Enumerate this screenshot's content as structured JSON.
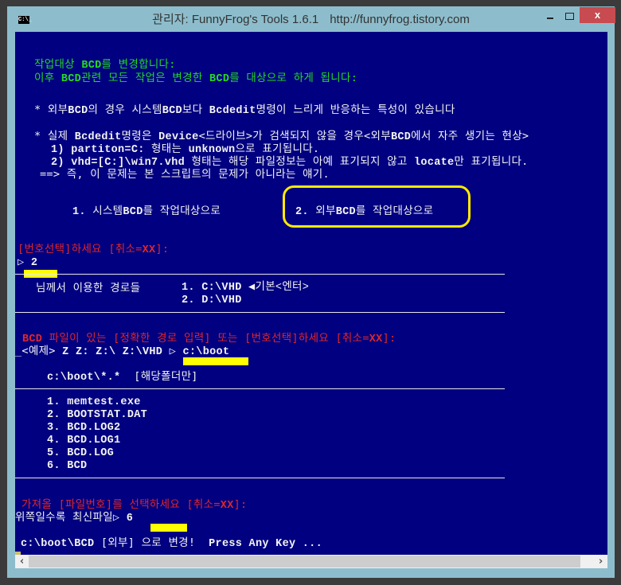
{
  "window": {
    "title": "관리자:  FunnyFrog's Tools 1.6.1",
    "url": "http://funnyfrog.tistory.com",
    "app_icon": "C:\\_",
    "close_label": "x"
  },
  "colors": {
    "background": "#000080",
    "green": "#25d925",
    "white": "#f4f4f4",
    "red": "#e0262a",
    "highlight": "#ffff00"
  },
  "console": {
    "header": {
      "line1_a": "작업대상 ",
      "line1_b": "BCD",
      "line1_c": "를 변경합니다:",
      "line2_a": "이후 ",
      "line2_b": "BCD",
      "line2_c": "관련 모든 작업은 변경한 ",
      "line2_d": "BCD",
      "line2_e": "를 대상으로 하게 됩니다:"
    },
    "note1": {
      "a": "* 외부",
      "b": "BCD",
      "c": "의 경우 시스템",
      "d": "BCD",
      "e": "보다 ",
      "f": "Bcdedit",
      "g": "명령이 느리게 반응하는 특성이 있습니다"
    },
    "note2": {
      "a": "* 실제 ",
      "b": "Bcdedit",
      "c": "명령은 ",
      "d": "Device",
      "e": "<드라이브>가 검색되지 않을 경우<외부",
      "f": "BCD",
      "g": "에서 자주 생기는 현상>",
      "sub1_a": "1) partiton=C:",
      "sub1_b": " 형태는 ",
      "sub1_c": "unknown",
      "sub1_d": "으로 표기됩니다.",
      "sub2_a": "2) vhd=[C:]\\win7.vhd",
      "sub2_b": " 형태는 해당 파일정보는 아예 표기되지 않고 ",
      "sub2_c": "locate",
      "sub2_d": "만 표기됩니다.",
      "conclusion": "==> 즉, 이 문제는 본 스크립트의 문제가 아니라는 얘기."
    },
    "options": [
      {
        "num": "1.",
        "a": " 시스템",
        "b": "BCD",
        "c": "를 작업대상으로"
      },
      {
        "num": "2.",
        "a": " 외부",
        "b": "BCD",
        "c": "를 작업대상으로",
        "highlighted": true
      }
    ],
    "prompt1": {
      "a": "[번호선택]하세요 [취소=",
      "b": "XX",
      "c": "]:",
      "arrow": "▷",
      "input": "2"
    },
    "paths": {
      "label": "님께서 이용한 경로들",
      "items": [
        {
          "num": "1.",
          "path": "C:\\VHD",
          "note": "◀기본<엔터>"
        },
        {
          "num": "2.",
          "path": "D:\\VHD",
          "note": ""
        }
      ]
    },
    "prompt2": {
      "a": "BCD",
      "b": " 파일이 있는 [정확한 경로 입력] 또는 [번호선택]하세요 [취소=",
      "c": "XX",
      "d": "]:",
      "example_a": "_<예제> ",
      "example_b": "Z Z: Z:\\ Z:\\VHD",
      "arrow": " ▷ ",
      "input": "c:\\boot"
    },
    "folder": {
      "path": "c:\\boot\\*.*",
      "note": "[해당폴더만]"
    },
    "files": [
      {
        "num": "1.",
        "name": "memtest.exe"
      },
      {
        "num": "2.",
        "name": "BOOTSTAT.DAT"
      },
      {
        "num": "3.",
        "name": "BCD.LOG2"
      },
      {
        "num": "4.",
        "name": "BCD.LOG1"
      },
      {
        "num": "5.",
        "name": "BCD.LOG"
      },
      {
        "num": "6.",
        "name": "BCD"
      }
    ],
    "prompt3": {
      "a": "가져올 [파일번호]를 선택하세요 [취소=",
      "b": "XX",
      "c": "]:",
      "hint": "위쪽일수록 최신파일",
      "arrow": "▷",
      "input": "6"
    },
    "result": {
      "a": "c:\\boot\\BCD",
      "b": " [외부] 으로 변경! ",
      "c": " Press Any Key ..."
    }
  }
}
